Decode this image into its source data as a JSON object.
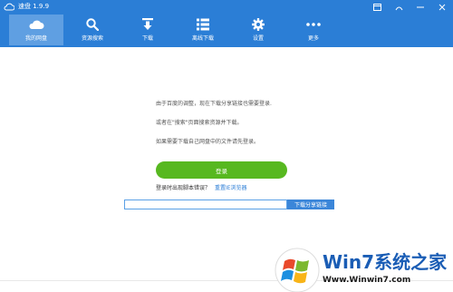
{
  "window": {
    "title": "速盘 1.9.9",
    "controls": [
      "skin-icon",
      "restore-icon",
      "minimize-icon",
      "close-icon"
    ]
  },
  "nav": {
    "items": [
      {
        "label": "我的网盘",
        "icon": "cloud-icon",
        "active": true
      },
      {
        "label": "资源搜索",
        "icon": "search-icon",
        "active": false
      },
      {
        "label": "下载",
        "icon": "download-icon",
        "active": false
      },
      {
        "label": "离线下载",
        "icon": "list-icon",
        "active": false
      },
      {
        "label": "设置",
        "icon": "gear-icon",
        "active": false
      },
      {
        "label": "更多",
        "icon": "more-icon",
        "active": false
      }
    ]
  },
  "main": {
    "messages": [
      "由于百度的调整，现在下载分享链接也需要登录.",
      "或者在\"搜索\"页面搜索资源并下载。",
      "如果需要下载自己网盘中的文件请先登录。"
    ],
    "login_label": "登录",
    "help_text": "登录时出现脚本错误？",
    "reset_link": "重置IE浏览器",
    "share_input": {
      "value": "",
      "placeholder": ""
    },
    "share_button": "下载分享链接"
  },
  "colors": {
    "header": "#2b7ed6",
    "active_tab": "#5f9fe2",
    "login": "#57b820",
    "link": "#2b7ed6"
  },
  "watermark": {
    "text": "Win7系统之家",
    "url": "Www.Winwin7.com"
  }
}
